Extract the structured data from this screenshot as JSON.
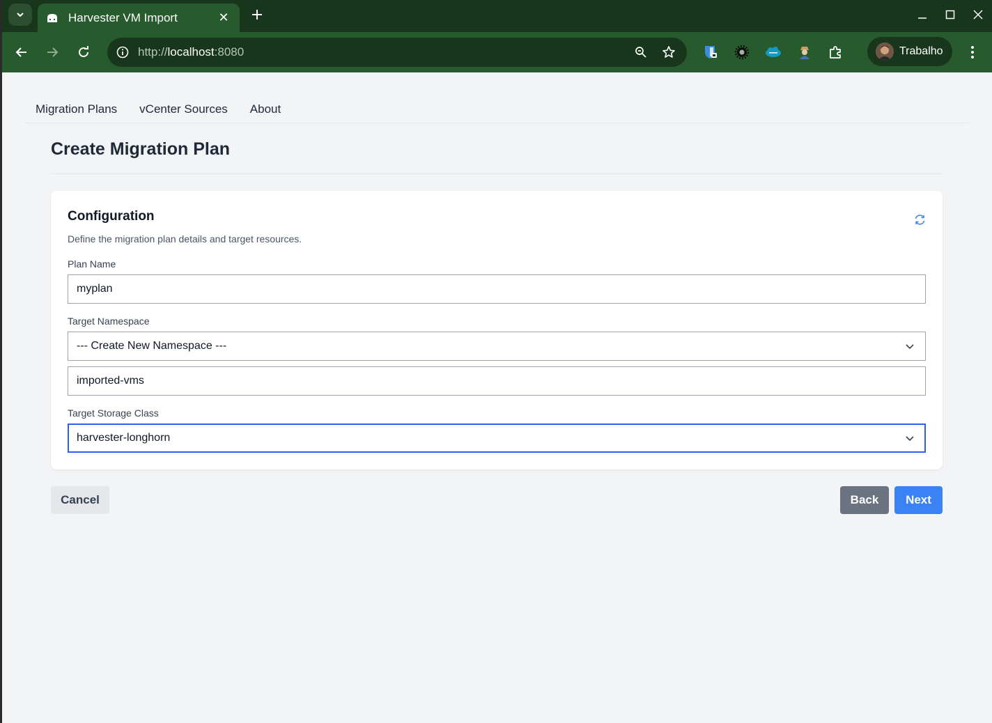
{
  "browser": {
    "tab_title": "Harvester VM Import",
    "url_scheme": "http://",
    "url_host": "localhost",
    "url_port": ":8080",
    "profile_name": "Trabalho",
    "theme_colors": {
      "frame": "#17361b",
      "toolbar": "#275a2c"
    }
  },
  "nav": {
    "items": [
      "Migration Plans",
      "vCenter Sources",
      "About"
    ]
  },
  "page": {
    "title": "Create Migration Plan"
  },
  "card": {
    "title": "Configuration",
    "description": "Define the migration plan details and target resources.",
    "plan_name_label": "Plan Name",
    "plan_name_value": "myplan",
    "namespace_label": "Target Namespace",
    "namespace_selected": "--- Create New Namespace ---",
    "new_namespace_value": "imported-vms",
    "storage_label": "Target Storage Class",
    "storage_selected": "harvester-longhorn"
  },
  "buttons": {
    "cancel": "Cancel",
    "back": "Back",
    "next": "Next"
  },
  "colors": {
    "primary": "#3b82f6",
    "secondary": "#6b7280",
    "focus_border": "#2563eb"
  }
}
